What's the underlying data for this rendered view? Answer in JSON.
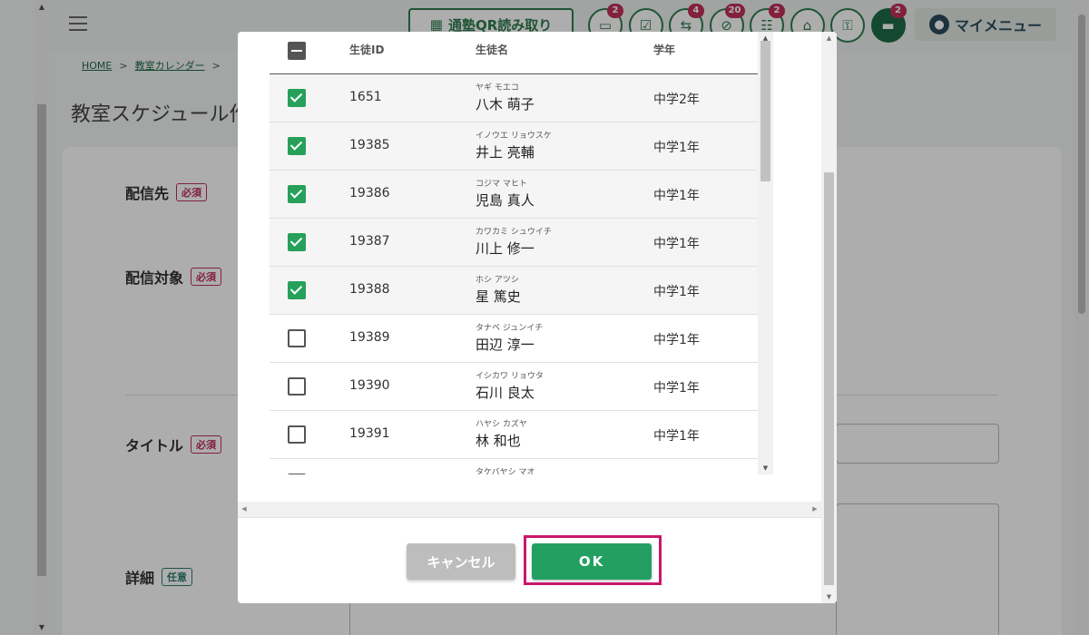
{
  "header": {
    "qr_label": "通塾QR読み取り",
    "icons": [
      {
        "name": "message-box-icon",
        "glyph": "▭",
        "badge": "2"
      },
      {
        "name": "checklist-icon",
        "glyph": "☑",
        "badge": ""
      },
      {
        "name": "transfer-icon",
        "glyph": "⇆",
        "badge": "4"
      },
      {
        "name": "no-entry-icon",
        "glyph": "⊘",
        "badge": "20"
      },
      {
        "name": "group-icon",
        "glyph": "☷",
        "badge": "2"
      },
      {
        "name": "school-icon",
        "glyph": "⌂",
        "badge": ""
      },
      {
        "name": "gift-icon",
        "glyph": "⚿",
        "badge": ""
      },
      {
        "name": "chat-icon",
        "glyph": "▬",
        "badge": "2"
      }
    ],
    "mymenu_label": "マイメニュー"
  },
  "breadcrumb": {
    "home": "HOME",
    "sep": ">",
    "calendar": "教室カレンダー"
  },
  "page": {
    "title": "教室スケジュール作",
    "fields": {
      "destination": "配信先",
      "target": "配信対象",
      "title": "タイトル",
      "detail": "詳細",
      "required": "必須",
      "optional": "任意"
    }
  },
  "modal": {
    "columns": {
      "id": "生徒ID",
      "name": "生徒名",
      "grade": "学年"
    },
    "rows": [
      {
        "checked": true,
        "id": "1651",
        "kana": "ヤギ モエコ",
        "name": "八木 萌子",
        "grade": "中学2年"
      },
      {
        "checked": true,
        "id": "19385",
        "kana": "イノウエ リョウスケ",
        "name": "井上 亮輔",
        "grade": "中学1年"
      },
      {
        "checked": true,
        "id": "19386",
        "kana": "コジマ マヒト",
        "name": "児島 真人",
        "grade": "中学1年"
      },
      {
        "checked": true,
        "id": "19387",
        "kana": "カワカミ シュウイチ",
        "name": "川上 修一",
        "grade": "中学1年"
      },
      {
        "checked": true,
        "id": "19388",
        "kana": "ホシ アツシ",
        "name": "星 篤史",
        "grade": "中学1年"
      },
      {
        "checked": false,
        "id": "19389",
        "kana": "タナベ ジュンイチ",
        "name": "田辺 淳一",
        "grade": "中学1年"
      },
      {
        "checked": false,
        "id": "19390",
        "kana": "イシカワ リョウタ",
        "name": "石川 良太",
        "grade": "中学1年"
      },
      {
        "checked": false,
        "id": "19391",
        "kana": "ハヤシ カズヤ",
        "name": "林 和也",
        "grade": "中学1年"
      },
      {
        "checked": false,
        "id": "",
        "kana": "タケバヤシ マオ",
        "name": "",
        "grade": ""
      }
    ],
    "cancel_label": "キャンセル",
    "ok_label": "OK"
  },
  "colors": {
    "brand": "#1e6b47",
    "ok": "#23a061",
    "badge": "#c0305a",
    "highlight": "#c9186c"
  }
}
